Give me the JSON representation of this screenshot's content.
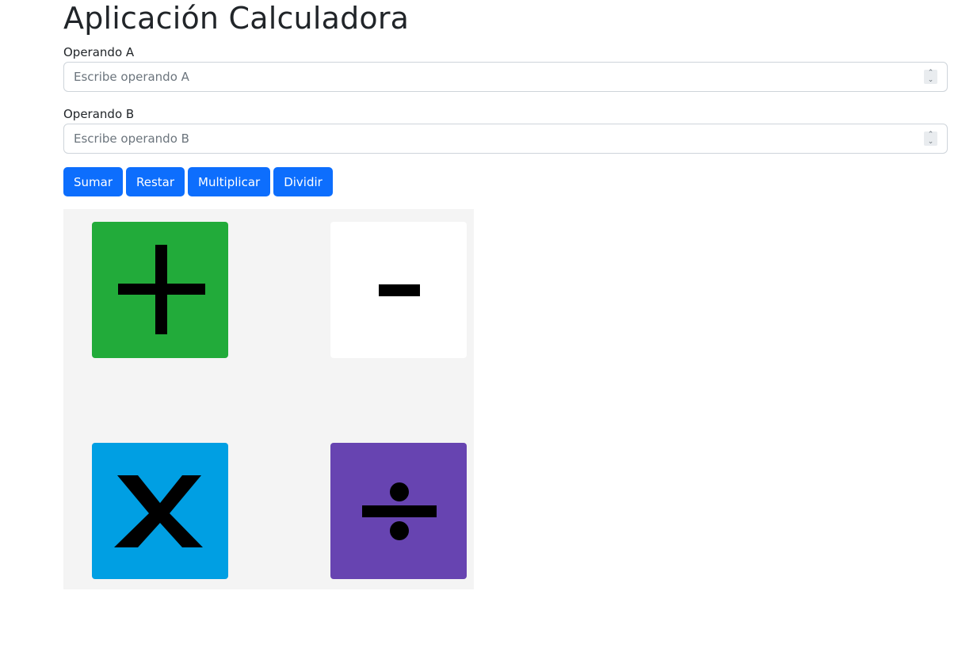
{
  "header": {
    "title": "Aplicación Calculadora"
  },
  "form": {
    "operand_a": {
      "label": "Operando A",
      "placeholder": "Escribe operando A",
      "value": ""
    },
    "operand_b": {
      "label": "Operando B",
      "placeholder": "Escribe operando B",
      "value": ""
    }
  },
  "buttons": {
    "sum": "Sumar",
    "subtract": "Restar",
    "multiply": "Multiplicar",
    "divide": "Dividir"
  },
  "operation_tiles": [
    {
      "icon": "plus-icon",
      "color": "#22ab3a"
    },
    {
      "icon": "minus-icon",
      "color": "#ffffff"
    },
    {
      "icon": "multiply-icon",
      "color": "#009fe3"
    },
    {
      "icon": "divide-icon",
      "color": "#6744b1"
    }
  ],
  "colors": {
    "primary_button": "#0d6efd",
    "panel_background": "#f4f4f4",
    "glyph": "#000000"
  }
}
